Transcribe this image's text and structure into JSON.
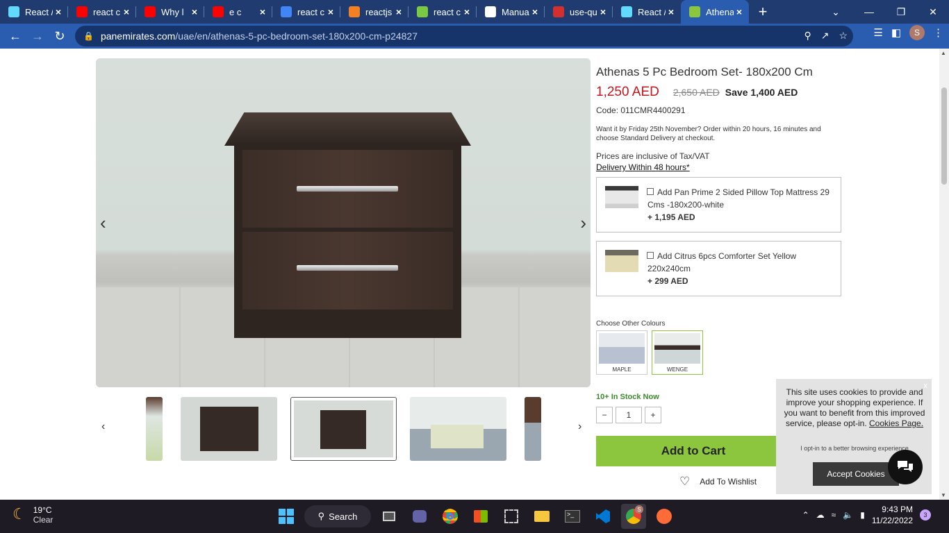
{
  "browser": {
    "tabs": [
      {
        "title": "React /",
        "icon": "react-icon",
        "color": "#61dafb"
      },
      {
        "title": "react c",
        "icon": "youtube-icon",
        "color": "#ff0000"
      },
      {
        "title": "Why l",
        "icon": "youtube-icon",
        "color": "#ff0000"
      },
      {
        "title": "e c",
        "icon": "youtube-icon",
        "color": "#ff0000"
      },
      {
        "title": "react c",
        "icon": "google-icon",
        "color": "#4285f4"
      },
      {
        "title": "reactjs",
        "icon": "stackoverflow-icon",
        "color": "#f48024"
      },
      {
        "title": "react c",
        "icon": "sparkle-icon",
        "color": "#7ac943"
      },
      {
        "title": "Manua",
        "icon": "github-icon",
        "color": "#ffffff"
      },
      {
        "title": "use-qu",
        "icon": "n-icon",
        "color": "#d32f2f"
      },
      {
        "title": "React /",
        "icon": "react-icon",
        "color": "#61dafb"
      },
      {
        "title": "Athena",
        "icon": "pan-emirates-icon",
        "color": "#8cc63f"
      }
    ],
    "url_host": "panemirates.com",
    "url_path": "/uae/en/athenas-5-pc-bedroom-set-180x200-cm-p24827",
    "profile_initial": "S"
  },
  "product": {
    "title": "Athenas 5 Pc Bedroom Set- 180x200 Cm",
    "price_now": "1,250 AED",
    "price_old": "2,650 AED",
    "price_save": "Save 1,400 AED",
    "code": "Code: 011CMR4400291",
    "delivery_note": "Want it by Friday 25th November? Order within 20 hours, 16 minutes and choose Standard Delivery at checkout.",
    "vat": "Prices are inclusive of Tax/VAT",
    "delivery_link": "Delivery Within 48 hours*",
    "addons": [
      {
        "name": "Add Pan Prime 2 Sided Pillow Top Mattress 29 Cms -180x200-white",
        "price": "+ 1,195 AED"
      },
      {
        "name": "Add Citrus 6pcs Comforter Set Yellow 220x240cm",
        "price": "+ 299 AED"
      }
    ],
    "colours_label": "Choose Other Colours",
    "colours": [
      {
        "name": "MAPLE"
      },
      {
        "name": "WENGE"
      }
    ],
    "stock": "10+ In Stock Now",
    "quantity": "1",
    "qty_minus": "−",
    "qty_plus": "+",
    "add_to_cart": "Add to Cart",
    "wishlist": "Add To Wishlist"
  },
  "cookie": {
    "text": "This site uses cookies to provide and improve your shopping experience. If you want to benefit from this improved service, please opt-in.",
    "link": "Cookies Page.",
    "optin": "I opt-in to a better browsing experience",
    "button": "Accept Cookies",
    "close": "x"
  },
  "taskbar": {
    "temp": "19°C",
    "condition": "Clear",
    "search": "Search",
    "time": "9:43 PM",
    "date": "11/22/2022",
    "notifications": "3",
    "chrome_badge": "S"
  },
  "colors": {
    "accent_green": "#8cc63f",
    "price_red": "#c3161d",
    "stock_green": "#3b8a2a",
    "chrome_blue": "#2a5db0"
  }
}
